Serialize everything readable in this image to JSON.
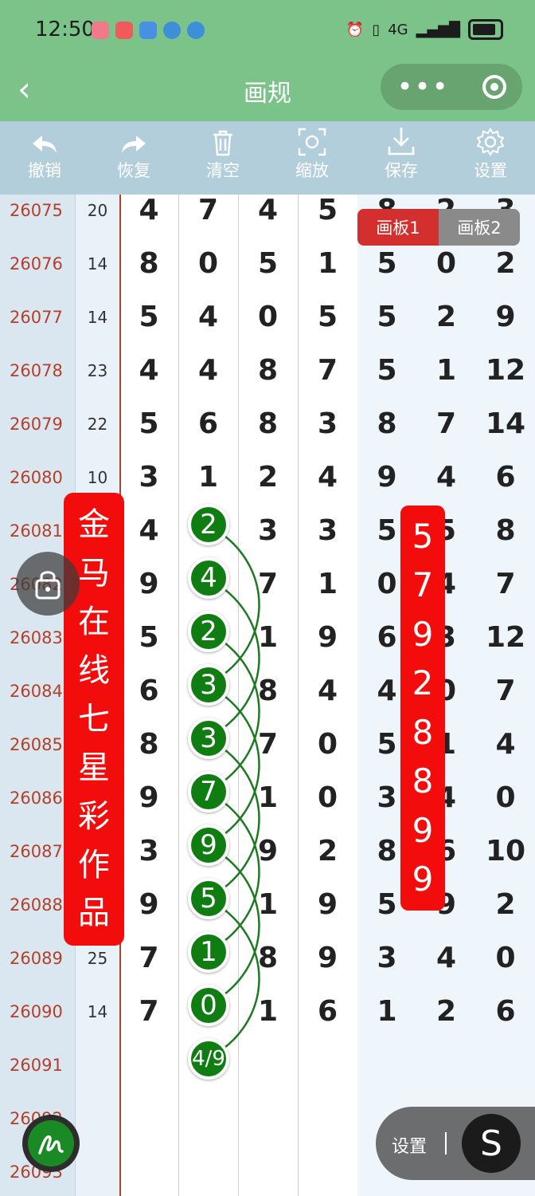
{
  "status": {
    "time": "12:50",
    "network": "4G"
  },
  "nav": {
    "title": "画规",
    "more": "•••"
  },
  "toolbar": [
    {
      "label": "撤销",
      "icon": "undo-icon"
    },
    {
      "label": "恢复",
      "icon": "redo-icon"
    },
    {
      "label": "清空",
      "icon": "trash-icon"
    },
    {
      "label": "缩放",
      "icon": "zoom-icon"
    },
    {
      "label": "保存",
      "icon": "download-icon"
    },
    {
      "label": "设置",
      "icon": "gear-icon"
    }
  ],
  "tabs": [
    "画板1",
    "画板2"
  ],
  "rows": [
    {
      "issue": "26075",
      "sum": "20",
      "d": [
        "4",
        "7",
        "4",
        "5",
        "8",
        "2",
        "3"
      ]
    },
    {
      "issue": "26076",
      "sum": "14",
      "d": [
        "8",
        "0",
        "5",
        "1",
        "5",
        "0",
        "2"
      ]
    },
    {
      "issue": "26077",
      "sum": "14",
      "d": [
        "5",
        "4",
        "0",
        "5",
        "5",
        "2",
        "9"
      ]
    },
    {
      "issue": "26078",
      "sum": "23",
      "d": [
        "4",
        "4",
        "8",
        "7",
        "5",
        "1",
        "12"
      ]
    },
    {
      "issue": "26079",
      "sum": "22",
      "d": [
        "5",
        "6",
        "8",
        "3",
        "8",
        "7",
        "14"
      ]
    },
    {
      "issue": "26080",
      "sum": "10",
      "d": [
        "3",
        "1",
        "2",
        "4",
        "9",
        "4",
        "6"
      ]
    },
    {
      "issue": "26081",
      "sum": "",
      "d": [
        "4",
        "",
        "3",
        "3",
        "5",
        "5",
        "8"
      ]
    },
    {
      "issue": "26082",
      "sum": "",
      "d": [
        "9",
        "",
        "7",
        "1",
        "0",
        "4",
        "7"
      ]
    },
    {
      "issue": "26083",
      "sum": "",
      "d": [
        "5",
        "",
        "1",
        "9",
        "6",
        "3",
        "12"
      ]
    },
    {
      "issue": "26084",
      "sum": "",
      "d": [
        "6",
        "",
        "8",
        "4",
        "4",
        "0",
        "7"
      ]
    },
    {
      "issue": "26085",
      "sum": "",
      "d": [
        "8",
        "",
        "7",
        "0",
        "5",
        "1",
        "4"
      ]
    },
    {
      "issue": "26086",
      "sum": "",
      "d": [
        "9",
        "",
        "1",
        "0",
        "3",
        "4",
        "0"
      ]
    },
    {
      "issue": "26087",
      "sum": "",
      "d": [
        "3",
        "",
        "9",
        "2",
        "8",
        "6",
        "10"
      ]
    },
    {
      "issue": "26088",
      "sum": "",
      "d": [
        "9",
        "",
        "1",
        "9",
        "5",
        "9",
        "2"
      ]
    },
    {
      "issue": "26089",
      "sum": "25",
      "d": [
        "7",
        "",
        "8",
        "9",
        "3",
        "4",
        "0"
      ]
    },
    {
      "issue": "26090",
      "sum": "14",
      "d": [
        "7",
        "",
        "1",
        "6",
        "1",
        "2",
        "6"
      ]
    },
    {
      "issue": "26091",
      "sum": "",
      "d": [
        "",
        "",
        "",
        "",
        "",
        "",
        ""
      ]
    },
    {
      "issue": "26092",
      "sum": "",
      "d": [
        "",
        "",
        "",
        "",
        "",
        "",
        ""
      ]
    },
    {
      "issue": "26093",
      "sum": "",
      "d": [
        "",
        "",
        "",
        "",
        "",
        "",
        ""
      ]
    }
  ],
  "balls": [
    "2",
    "4",
    "2",
    "3",
    "3",
    "7",
    "9",
    "5",
    "1",
    "0",
    "4/9"
  ],
  "banner_left": [
    "金",
    "马",
    "在",
    "线",
    "七",
    "星",
    "彩",
    "作",
    "品"
  ],
  "banner_right": [
    "5",
    "7",
    "9",
    "2",
    "8",
    "8",
    "9",
    "9"
  ],
  "settings": {
    "label": "设置",
    "icon_glyph": "S"
  },
  "colors": {
    "nav_green": "#7cc38a",
    "toolbar": "#b3cedb",
    "accent_red": "#d32f2f",
    "ball_green": "#0f7d12",
    "border_red": "#b2402a"
  }
}
